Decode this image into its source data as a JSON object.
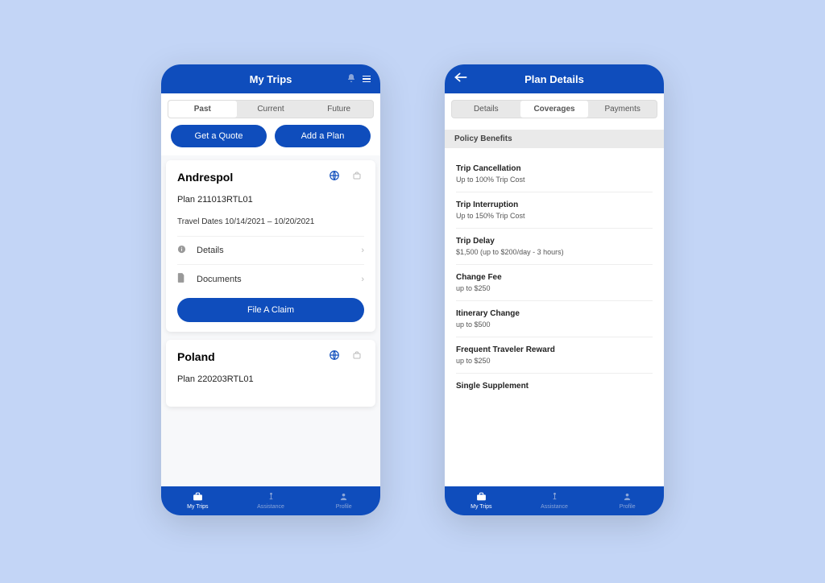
{
  "colors": {
    "brand": "#0f4dbc",
    "background": "#c3d5f6"
  },
  "phone1": {
    "header": {
      "title": "My Trips"
    },
    "segments": {
      "items": [
        "Past",
        "Current",
        "Future"
      ],
      "active": 0
    },
    "pills": {
      "quote": "Get a Quote",
      "addplan": "Add a Plan"
    },
    "cards": [
      {
        "title": "Andrespol",
        "plan_label": "Plan 211013RTL01",
        "dates": "Travel Dates 10/14/2021 – 10/20/2021",
        "links": {
          "details": "Details",
          "documents": "Documents"
        },
        "claim": "File A Claim"
      },
      {
        "title": "Poland",
        "plan_label": "Plan 220203RTL01"
      }
    ],
    "tabbar": {
      "mytrips": "My Trips",
      "assistance": "Assistance",
      "profile": "Profile"
    }
  },
  "phone2": {
    "header": {
      "title": "Plan Details"
    },
    "segments": {
      "items": [
        "Details",
        "Coverages",
        "Payments"
      ],
      "active": 1
    },
    "section": "Policy Benefits",
    "benefits": [
      {
        "title": "Trip Cancellation",
        "desc": "Up to 100% Trip Cost"
      },
      {
        "title": "Trip Interruption",
        "desc": "Up to 150% Trip Cost"
      },
      {
        "title": "Trip Delay",
        "desc": "$1,500 (up to $200/day - 3 hours)"
      },
      {
        "title": "Change Fee",
        "desc": "up to $250"
      },
      {
        "title": "Itinerary Change",
        "desc": "up to $500"
      },
      {
        "title": "Frequent Traveler Reward",
        "desc": "up to $250"
      },
      {
        "title": "Single Supplement",
        "desc": ""
      }
    ],
    "tabbar": {
      "mytrips": "My Trips",
      "assistance": "Assistance",
      "profile": "Profile"
    }
  }
}
